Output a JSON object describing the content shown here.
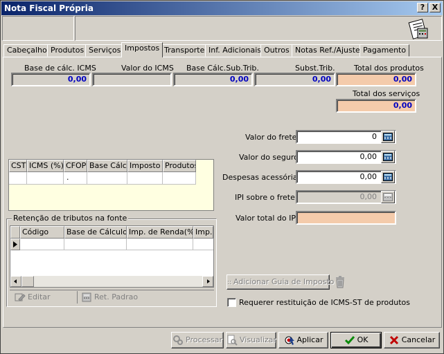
{
  "window": {
    "title": "Nota Fiscal Própria",
    "help_label": "?",
    "close_label": "X"
  },
  "tabs": [
    {
      "label": "Cabeçalho"
    },
    {
      "label": "Produtos"
    },
    {
      "label": "Serviços"
    },
    {
      "label": "Impostos"
    },
    {
      "label": "Transporte"
    },
    {
      "label": "Inf. Adicionais"
    },
    {
      "label": "Outros"
    },
    {
      "label": "Notas Ref./Ajuste"
    },
    {
      "label": "Pagamento"
    }
  ],
  "active_tab": "Impostos",
  "totals": {
    "base_calc_icms": {
      "label": "Base de cálc. ICMS",
      "value": "0,00"
    },
    "valor_icms": {
      "label": "Valor do ICMS",
      "value": ""
    },
    "base_calc_sub": {
      "label": "Base Cálc.Sub.Trib.",
      "value": "0,00"
    },
    "subst_trib": {
      "label": "Subst.Trib.",
      "value": "0,00"
    },
    "total_produtos": {
      "label": "Total dos produtos",
      "value": "0,00"
    },
    "total_servicos": {
      "label": "Total dos serviços",
      "value": "0,00"
    }
  },
  "fields": {
    "frete": {
      "label": "Valor do frete",
      "value": "0"
    },
    "seguro": {
      "label": "Valor do seguro",
      "value": "0,00"
    },
    "despesas": {
      "label": "Despesas acessórias",
      "value": "0,00"
    },
    "ipi_frete": {
      "label": "IPI sobre o frete",
      "value": "0,00"
    },
    "total_ipi": {
      "label": "Valor total do IPI",
      "value": ""
    }
  },
  "icms_grid": {
    "columns": [
      "CST",
      "ICMS (%)",
      "CFOP",
      "Base Cálc.",
      "Imposto",
      "Produtos"
    ],
    "row": [
      "",
      "",
      ".",
      "",
      "",
      ""
    ]
  },
  "retencao": {
    "title": "Retenção de tributos na fonte",
    "columns": [
      "Código",
      "Base de Cálculo",
      "Imp. de Renda(%)",
      "Imp. d"
    ],
    "editar_label": "Editar",
    "ret_padrao_label": "Ret. Padrao"
  },
  "guia": {
    "adicionar_label": "Adicionar Guia de Imposto",
    "requerer_label": "Requerer restituição de ICMS-ST de produtos",
    "requerer_checked": false
  },
  "footer": {
    "processar": "Processar",
    "visualizar": "Visualizar",
    "aplicar": "Aplicar",
    "ok": "OK",
    "cancelar": "Cancelar"
  },
  "colors": {
    "accent": "#0a246a",
    "peach": "#f4cbab",
    "grid_bg": "#ffffe1",
    "value_blue": "#0000c0"
  }
}
